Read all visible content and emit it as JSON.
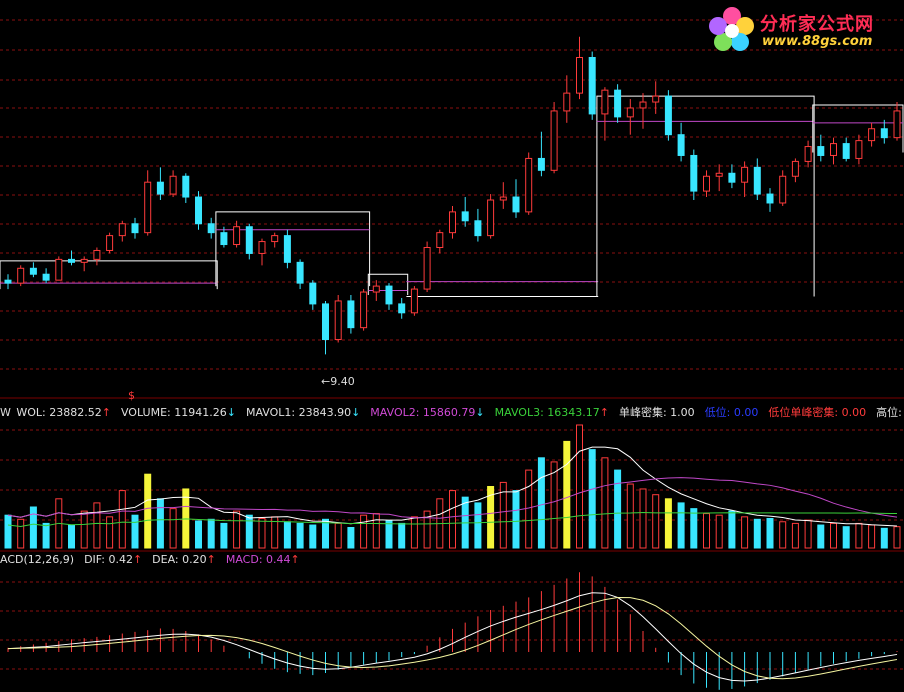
{
  "price_panel": {
    "low_marker": "←9.40",
    "dollar_marker": "$"
  },
  "volume_legend": {
    "prefix": "W",
    "items": [
      {
        "text": "WOL: 23882.52",
        "arrow": "↑",
        "color": "#e0e0e0",
        "arrow_color": "#ff3b3b"
      },
      {
        "text": "VOLUME: 11941.26",
        "arrow": "↓",
        "color": "#e0e0e0",
        "arrow_color": "#39e6ff"
      },
      {
        "text": "MAVOL1: 23843.90",
        "arrow": "↓",
        "color": "#e0e0e0",
        "arrow_color": "#39e6ff"
      },
      {
        "text": "MAVOL2: 15860.79",
        "arrow": "↓",
        "color": "#d04bd6",
        "arrow_color": "#39e6ff"
      },
      {
        "text": "MAVOL3: 16343.17",
        "arrow": "↑",
        "color": "#3ad13a",
        "arrow_color": "#ff3b3b"
      },
      {
        "text": "单峰密集: 1.00",
        "arrow": "",
        "color": "#e0e0e0",
        "arrow_color": ""
      },
      {
        "text": "低位: 0.00",
        "arrow": "",
        "color": "#2a3cff",
        "arrow_color": ""
      },
      {
        "text": "低位单峰密集: 0.00",
        "arrow": "",
        "color": "#ff3b3b",
        "arrow_color": ""
      },
      {
        "text": "高位: 0",
        "arrow": "",
        "color": "#e0e0e0",
        "arrow_color": ""
      }
    ]
  },
  "macd_legend": {
    "items": [
      {
        "text": "ACD(12,26,9)",
        "arrow": "",
        "color": "#e0e0e0",
        "arrow_color": ""
      },
      {
        "text": "DIF: 0.42",
        "arrow": "↑",
        "color": "#e0e0e0",
        "arrow_color": "#ff3b3b"
      },
      {
        "text": "DEA: 0.20",
        "arrow": "↑",
        "color": "#e0e0e0",
        "arrow_color": "#ff3b3b"
      },
      {
        "text": "MACD: 0.44",
        "arrow": "↑",
        "color": "#d04bd6",
        "arrow_color": "#ff3b3b"
      }
    ]
  },
  "watermark": {
    "title": "分析家公式网",
    "url": "www.88gs.com"
  },
  "colors": {
    "up": "#ff3b3b",
    "down": "#39e6ff",
    "grid": "#8a1010",
    "box": "#ffffff",
    "box_mid": "#c048c8",
    "vol_yellow": "#f5f53a",
    "ma_white": "#ffffff",
    "ma_magenta": "#c048c8",
    "ma_green": "#3ad13a",
    "dif": "#ffffff",
    "dea": "#f5f5a0"
  },
  "chart_data": {
    "type": "candlestick",
    "price_levels": {
      "low": 9.4
    },
    "boxes": [
      {
        "from": 0,
        "to": 16,
        "top": 12.55,
        "bottom": 11.6,
        "mid": 11.8
      },
      {
        "from": 17,
        "to": 28,
        "top": 14.2,
        "bottom": 11.7,
        "mid": 13.6
      },
      {
        "from": 29,
        "to": 31,
        "top": 12.1,
        "bottom": 11.4,
        "mid": 11.55
      },
      {
        "from": 32,
        "to": 46,
        "top": 11.35,
        "bottom": 11.35,
        "mid": 11.85
      },
      {
        "from": 47,
        "to": 63,
        "top": 18.1,
        "bottom": 11.35,
        "mid": 17.25
      },
      {
        "from": 64,
        "to": 70,
        "top": 17.8,
        "bottom": 16.2,
        "mid": 17.2
      }
    ],
    "candles": [
      [
        11.9,
        12.1,
        11.6,
        11.8
      ],
      [
        11.8,
        12.4,
        11.7,
        12.3
      ],
      [
        12.3,
        12.5,
        12.0,
        12.1
      ],
      [
        12.1,
        12.3,
        11.8,
        11.9
      ],
      [
        11.9,
        12.7,
        11.9,
        12.6
      ],
      [
        12.6,
        12.9,
        12.4,
        12.5
      ],
      [
        12.5,
        12.7,
        12.2,
        12.6
      ],
      [
        12.6,
        13.0,
        12.4,
        12.9
      ],
      [
        12.9,
        13.5,
        12.8,
        13.4
      ],
      [
        13.4,
        13.9,
        13.2,
        13.8
      ],
      [
        13.8,
        14.0,
        13.3,
        13.5
      ],
      [
        13.5,
        15.6,
        13.4,
        15.2
      ],
      [
        15.2,
        15.7,
        14.6,
        14.8
      ],
      [
        14.8,
        15.6,
        14.7,
        15.4
      ],
      [
        15.4,
        15.5,
        14.5,
        14.7
      ],
      [
        14.7,
        14.9,
        13.6,
        13.8
      ],
      [
        13.8,
        14.0,
        13.3,
        13.5
      ],
      [
        13.5,
        13.7,
        13.0,
        13.1
      ],
      [
        13.1,
        13.9,
        13.0,
        13.7
      ],
      [
        13.7,
        13.8,
        12.6,
        12.8
      ],
      [
        12.8,
        13.3,
        12.4,
        13.2
      ],
      [
        13.2,
        13.5,
        13.0,
        13.4
      ],
      [
        13.4,
        13.6,
        12.3,
        12.5
      ],
      [
        12.5,
        12.6,
        11.6,
        11.8
      ],
      [
        11.8,
        11.9,
        10.9,
        11.1
      ],
      [
        11.1,
        11.2,
        9.4,
        9.9
      ],
      [
        9.9,
        11.4,
        9.8,
        11.2
      ],
      [
        11.2,
        11.4,
        10.1,
        10.3
      ],
      [
        10.3,
        11.6,
        10.2,
        11.5
      ],
      [
        11.5,
        11.9,
        11.2,
        11.7
      ],
      [
        11.7,
        11.8,
        10.9,
        11.1
      ],
      [
        11.1,
        11.3,
        10.6,
        10.8
      ],
      [
        10.8,
        11.7,
        10.7,
        11.6
      ],
      [
        11.6,
        13.2,
        11.5,
        13.0
      ],
      [
        13.0,
        13.6,
        12.8,
        13.5
      ],
      [
        13.5,
        14.4,
        13.3,
        14.2
      ],
      [
        14.2,
        14.7,
        13.7,
        13.9
      ],
      [
        13.9,
        14.3,
        13.2,
        13.4
      ],
      [
        13.4,
        14.8,
        13.3,
        14.6
      ],
      [
        14.6,
        15.2,
        14.3,
        14.7
      ],
      [
        14.7,
        15.3,
        14.0,
        14.2
      ],
      [
        14.2,
        16.2,
        14.1,
        16.0
      ],
      [
        16.0,
        16.9,
        15.4,
        15.6
      ],
      [
        15.6,
        17.9,
        15.5,
        17.6
      ],
      [
        17.6,
        18.8,
        17.2,
        18.2
      ],
      [
        18.2,
        20.1,
        18.0,
        19.4
      ],
      [
        19.4,
        19.6,
        17.3,
        17.5
      ],
      [
        17.5,
        18.4,
        16.6,
        18.3
      ],
      [
        18.3,
        18.5,
        17.2,
        17.4
      ],
      [
        17.4,
        18.0,
        16.8,
        17.7
      ],
      [
        17.7,
        18.2,
        17.0,
        17.9
      ],
      [
        17.9,
        18.6,
        17.5,
        18.1
      ],
      [
        18.1,
        18.3,
        16.6,
        16.8
      ],
      [
        16.8,
        17.2,
        15.9,
        16.1
      ],
      [
        16.1,
        16.3,
        14.6,
        14.9
      ],
      [
        14.9,
        15.6,
        14.7,
        15.4
      ],
      [
        15.4,
        15.8,
        14.9,
        15.5
      ],
      [
        15.5,
        15.8,
        15.0,
        15.2
      ],
      [
        15.2,
        15.9,
        14.7,
        15.7
      ],
      [
        15.7,
        16.0,
        14.6,
        14.8
      ],
      [
        14.8,
        15.0,
        14.2,
        14.5
      ],
      [
        14.5,
        15.6,
        14.4,
        15.4
      ],
      [
        15.4,
        16.0,
        15.2,
        15.9
      ],
      [
        15.9,
        16.6,
        15.7,
        16.4
      ],
      [
        16.4,
        16.8,
        15.9,
        16.1
      ],
      [
        16.1,
        16.7,
        15.8,
        16.5
      ],
      [
        16.5,
        16.7,
        15.9,
        16.0
      ],
      [
        16.0,
        16.8,
        15.8,
        16.6
      ],
      [
        16.6,
        17.2,
        16.4,
        17.0
      ],
      [
        17.0,
        17.3,
        16.5,
        16.7
      ],
      [
        16.7,
        17.9,
        16.6,
        17.6
      ]
    ],
    "volume": [
      40,
      35,
      50,
      30,
      60,
      28,
      45,
      55,
      38,
      70,
      40,
      90,
      60,
      48,
      72,
      33,
      35,
      30,
      45,
      40,
      36,
      38,
      32,
      30,
      28,
      35,
      30,
      25,
      40,
      42,
      33,
      30,
      38,
      45,
      60,
      70,
      62,
      55,
      75,
      80,
      70,
      95,
      110,
      105,
      130,
      150,
      120,
      110,
      95,
      78,
      72,
      65,
      60,
      55,
      48,
      42,
      40,
      45,
      38,
      35,
      36,
      32,
      30,
      34,
      28,
      30,
      26,
      30,
      28,
      24,
      26
    ],
    "vol_yellow": [
      11,
      14,
      38,
      44,
      52
    ],
    "macd_hist": [
      0.1,
      0.14,
      0.18,
      0.22,
      0.26,
      0.3,
      0.33,
      0.36,
      0.4,
      0.44,
      0.48,
      0.52,
      0.56,
      0.55,
      0.5,
      0.42,
      0.3,
      0.15,
      0.0,
      -0.15,
      -0.28,
      -0.4,
      -0.48,
      -0.52,
      -0.55,
      -0.5,
      -0.42,
      -0.35,
      -0.3,
      -0.26,
      -0.2,
      -0.12,
      -0.05,
      0.15,
      0.35,
      0.55,
      0.7,
      0.85,
      1.0,
      1.1,
      1.2,
      1.3,
      1.45,
      1.6,
      1.75,
      1.9,
      1.8,
      1.55,
      1.25,
      0.9,
      0.5,
      0.1,
      -0.25,
      -0.55,
      -0.75,
      -0.85,
      -0.9,
      -0.88,
      -0.82,
      -0.74,
      -0.66,
      -0.58,
      -0.5,
      -0.42,
      -0.34,
      -0.28,
      -0.22,
      -0.16,
      -0.1,
      -0.05,
      0.02
    ]
  }
}
